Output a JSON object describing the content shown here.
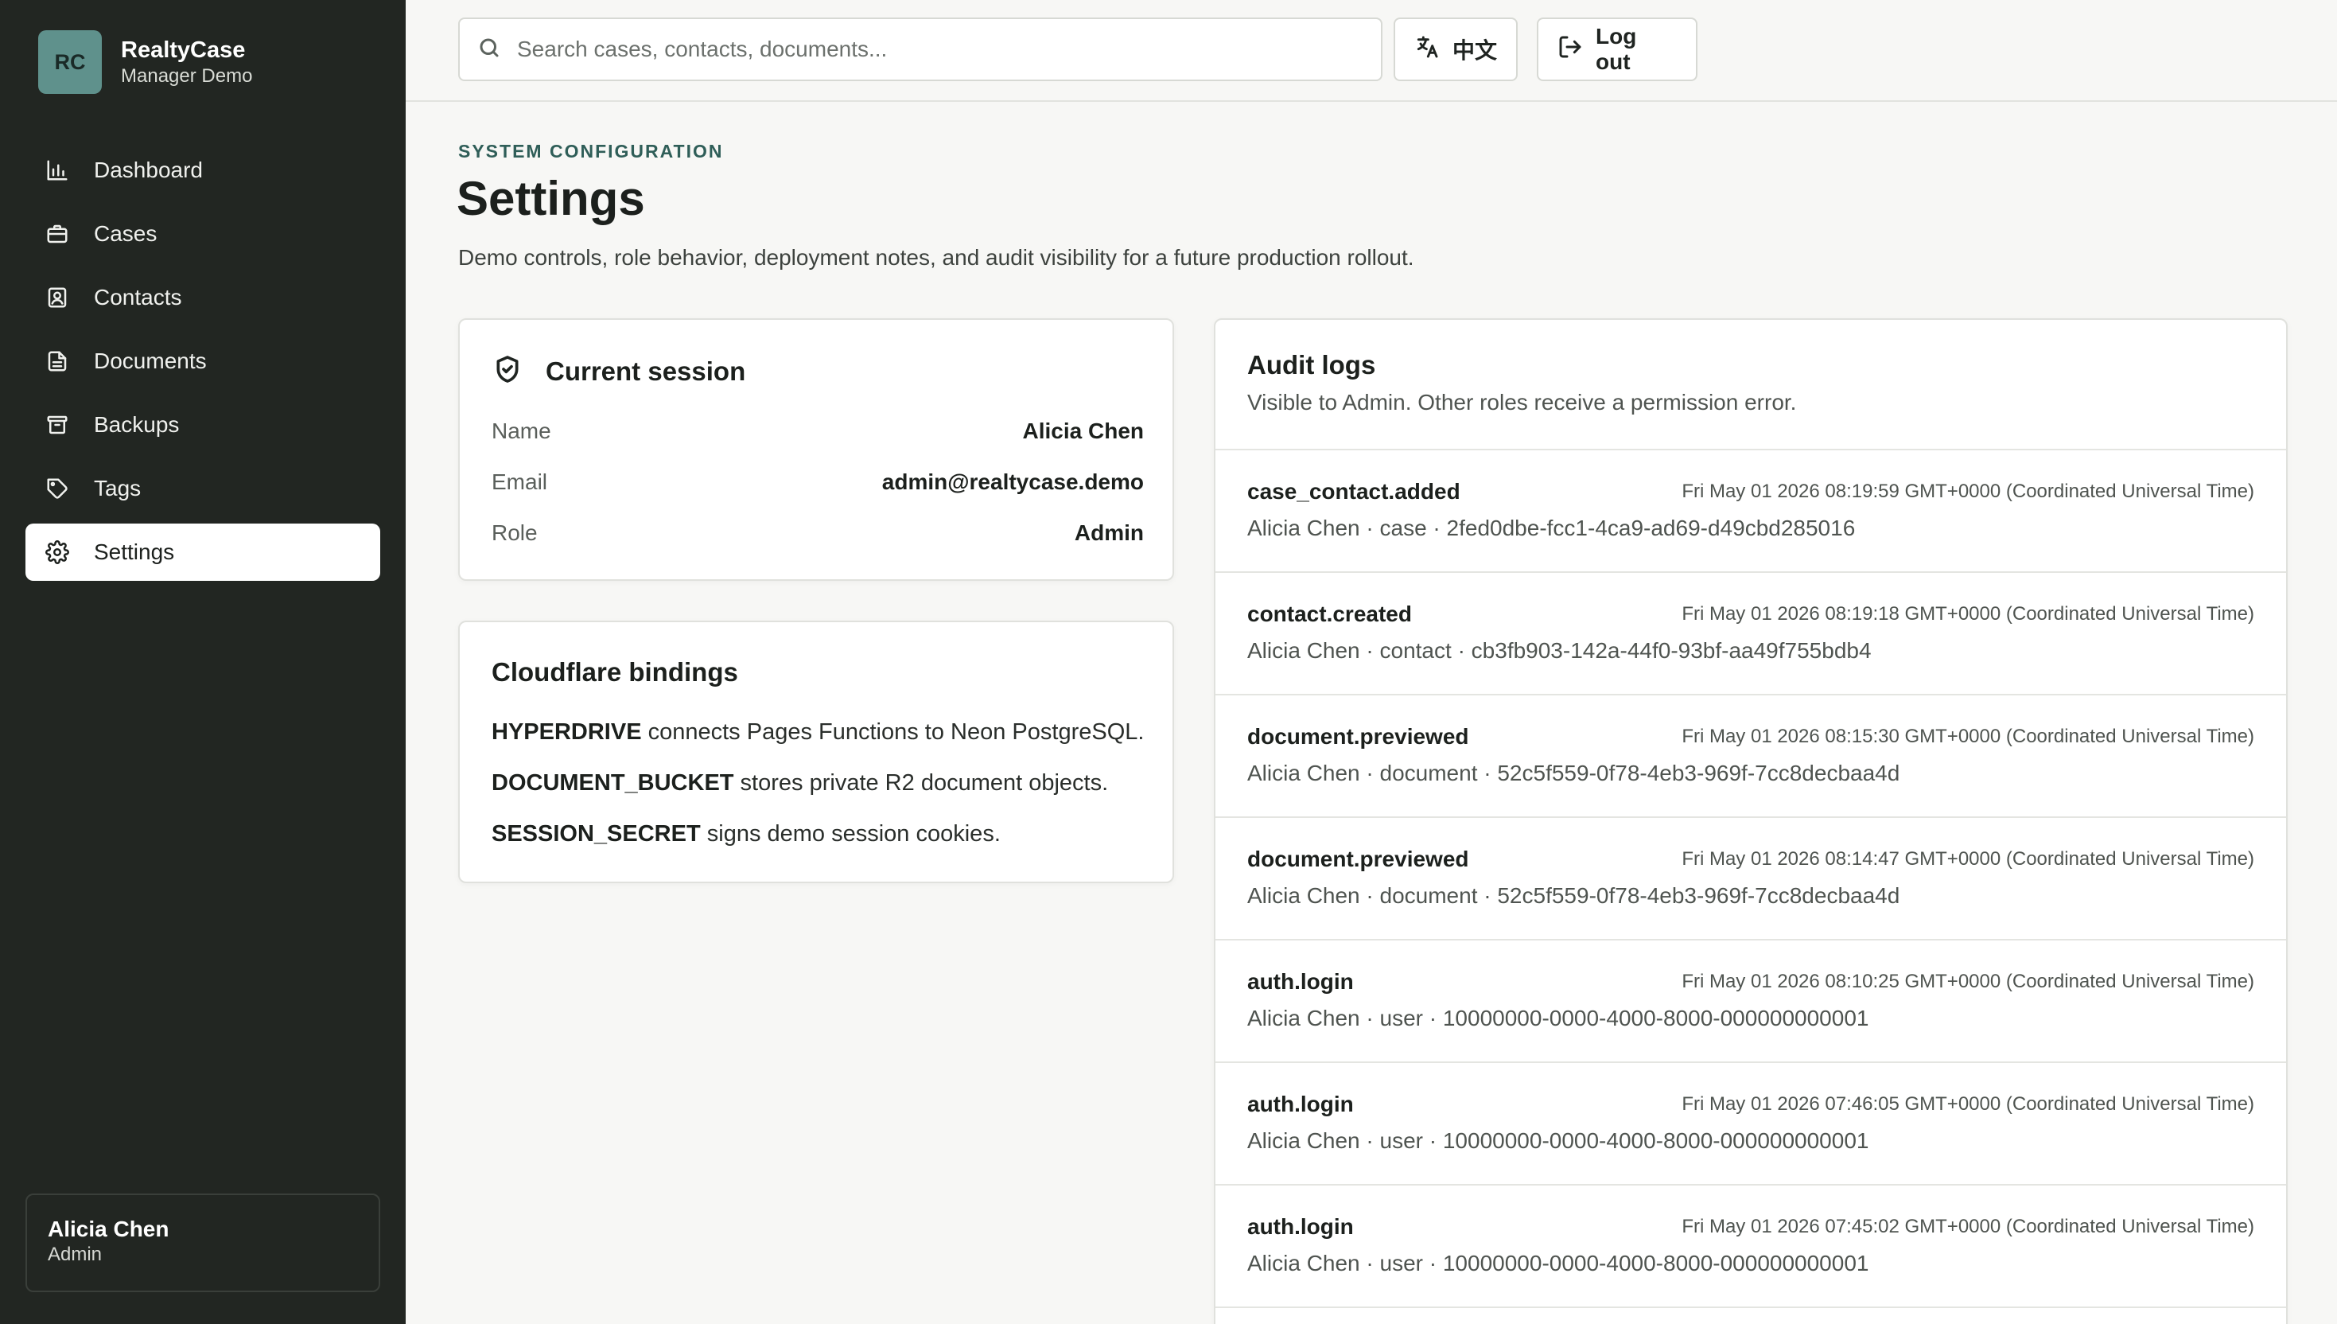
{
  "brand": {
    "initials": "RC",
    "name": "RealtyCase",
    "subtitle": "Manager Demo"
  },
  "sidebar": {
    "items": [
      {
        "label": "Dashboard",
        "icon": "bar-chart-icon",
        "active": false
      },
      {
        "label": "Cases",
        "icon": "briefcase-icon",
        "active": false
      },
      {
        "label": "Contacts",
        "icon": "contact-book-icon",
        "active": false
      },
      {
        "label": "Documents",
        "icon": "document-icon",
        "active": false
      },
      {
        "label": "Backups",
        "icon": "archive-icon",
        "active": false
      },
      {
        "label": "Tags",
        "icon": "tag-icon",
        "active": false
      },
      {
        "label": "Settings",
        "icon": "gear-icon",
        "active": true
      }
    ],
    "user": {
      "name": "Alicia Chen",
      "role": "Admin"
    }
  },
  "topbar": {
    "search_placeholder": "Search cases, contacts, documents...",
    "search_value": "",
    "language_label": "中文",
    "logout_label": "Log out"
  },
  "page": {
    "eyebrow": "SYSTEM CONFIGURATION",
    "title": "Settings",
    "description": "Demo controls, role behavior, deployment notes, and audit visibility for a future production rollout."
  },
  "session": {
    "title": "Current session",
    "rows": [
      {
        "label": "Name",
        "value": "Alicia Chen"
      },
      {
        "label": "Email",
        "value": "admin@realtycase.demo"
      },
      {
        "label": "Role",
        "value": "Admin"
      }
    ]
  },
  "bindings": {
    "title": "Cloudflare bindings",
    "lines": [
      {
        "key": "HYPERDRIVE",
        "text": " connects Pages Functions to Neon PostgreSQL."
      },
      {
        "key": "DOCUMENT_BUCKET",
        "text": " stores private R2 document objects."
      },
      {
        "key": "SESSION_SECRET",
        "text": " signs demo session cookies."
      }
    ]
  },
  "audit": {
    "title": "Audit logs",
    "subtitle": "Visible to Admin. Other roles receive a permission error.",
    "logs": [
      {
        "action": "case_contact.added",
        "time": "Fri May 01 2026 08:19:59 GMT+0000 (Coordinated Universal Time)",
        "detail": "Alicia Chen · case · 2fed0dbe-fcc1-4ca9-ad69-d49cbd285016"
      },
      {
        "action": "contact.created",
        "time": "Fri May 01 2026 08:19:18 GMT+0000 (Coordinated Universal Time)",
        "detail": "Alicia Chen · contact · cb3fb903-142a-44f0-93bf-aa49f755bdb4"
      },
      {
        "action": "document.previewed",
        "time": "Fri May 01 2026 08:15:30 GMT+0000 (Coordinated Universal Time)",
        "detail": "Alicia Chen · document · 52c5f559-0f78-4eb3-969f-7cc8decbaa4d"
      },
      {
        "action": "document.previewed",
        "time": "Fri May 01 2026 08:14:47 GMT+0000 (Coordinated Universal Time)",
        "detail": "Alicia Chen · document · 52c5f559-0f78-4eb3-969f-7cc8decbaa4d"
      },
      {
        "action": "auth.login",
        "time": "Fri May 01 2026 08:10:25 GMT+0000 (Coordinated Universal Time)",
        "detail": "Alicia Chen · user · 10000000-0000-4000-8000-000000000001"
      },
      {
        "action": "auth.login",
        "time": "Fri May 01 2026 07:46:05 GMT+0000 (Coordinated Universal Time)",
        "detail": "Alicia Chen · user · 10000000-0000-4000-8000-000000000001"
      },
      {
        "action": "auth.login",
        "time": "Fri May 01 2026 07:45:02 GMT+0000 (Coordinated Universal Time)",
        "detail": "Alicia Chen · user · 10000000-0000-4000-8000-000000000001"
      }
    ]
  },
  "colors": {
    "sidebar_bg": "#222622",
    "brand_logo_bg": "#5f918c",
    "accent": "#2f5e58",
    "page_bg": "#f7f7f5"
  }
}
